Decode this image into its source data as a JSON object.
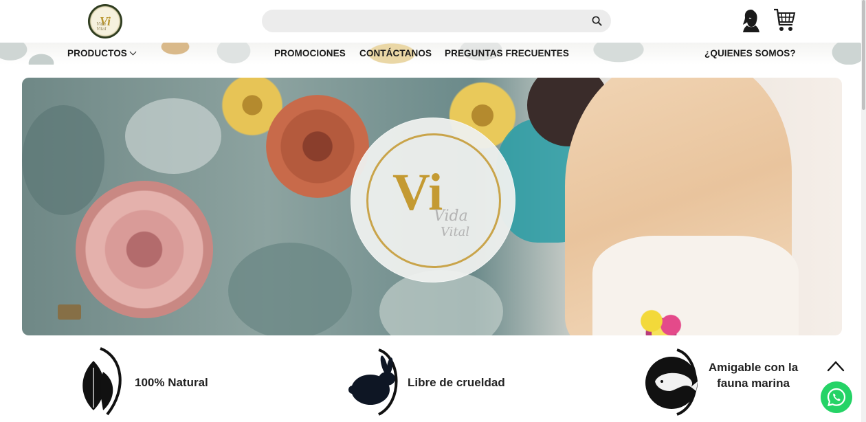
{
  "header": {
    "logo_mark": "Vi",
    "logo_sub": "Vida Vital",
    "search": {
      "placeholder": "",
      "value": ""
    },
    "icons": {
      "search": "search-icon",
      "account": "account-icon",
      "cart": "cart-icon"
    }
  },
  "nav": {
    "products": "PRODUCTOS",
    "promotions": "PROMOCIONES",
    "contact": "CONTÁCTANOS",
    "faq": "PREGUNTAS FRECUENTES",
    "about": "¿QUIENES SOMOS?"
  },
  "hero": {
    "badge_letters": "Vi",
    "badge_vida": "Vida",
    "badge_vital": "Vital"
  },
  "features": [
    {
      "label": "100% Natural",
      "icon": "leaf-icon"
    },
    {
      "label": "Libre de crueldad",
      "icon": "rabbit-icon"
    },
    {
      "label": "Amigable con la fauna marina",
      "icon": "whale-icon"
    }
  ],
  "colors": {
    "accent_gold": "#c49a32",
    "whatsapp": "#25d366",
    "text": "#1a1a1a"
  }
}
